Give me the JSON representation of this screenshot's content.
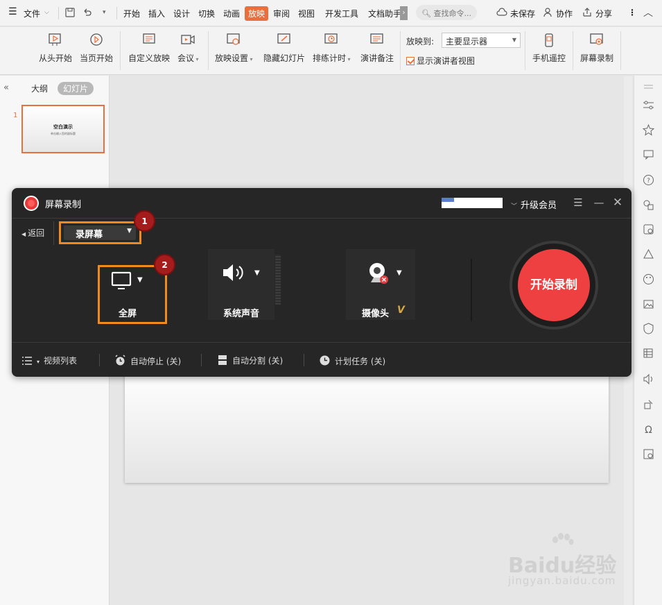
{
  "menubar": {
    "file": "文件",
    "tabs": [
      "开始",
      "插入",
      "设计",
      "切换",
      "动画",
      "放映",
      "审阅",
      "视图",
      "开发工具",
      "文档助手"
    ],
    "active_tab": "放映",
    "search_placeholder": "查找命令...",
    "unsaved": "未保存",
    "collaborate": "协作",
    "share": "分享"
  },
  "ribbon": {
    "from_start": "从头开始",
    "from_current": "当页开始",
    "custom_show": "自定义放映",
    "meeting": "会议",
    "show_settings": "放映设置",
    "hide_slide": "隐藏幻灯片",
    "rehearse": "排练计时",
    "speaker_notes": "演讲备注",
    "show_to_label": "放映到:",
    "monitor_value": "主要显示器",
    "presenter_view": "显示演讲者视图",
    "phone_remote": "手机遥控",
    "screen_record": "屏幕录制"
  },
  "leftpanel": {
    "outline_tab": "大纲",
    "slides_tab": "幻灯片",
    "slide_number": "1",
    "thumb_title": "空白演示",
    "thumb_subtitle": "单击输入您的副标题"
  },
  "recorder": {
    "title": "屏幕录制",
    "upgrade": "升级会员",
    "back": "返回",
    "mode": "录屏幕",
    "badge1": "1",
    "badge2": "2",
    "fullscreen": "全屏",
    "system_sound": "系统声音",
    "camera": "摄像头",
    "vip_mark": "V",
    "start": "开始录制",
    "video_list": "视频列表",
    "auto_stop": "自动停止 (关)",
    "auto_split": "自动分割 (关)",
    "schedule": "计划任务 (关)"
  },
  "watermark": {
    "brand": "Baidu经验",
    "url": "jingyan.baidu.com"
  },
  "colors": {
    "accent": "#e9703d",
    "highlight": "#f28a1a",
    "record": "#ee4040",
    "dialog_bg": "#262626"
  }
}
